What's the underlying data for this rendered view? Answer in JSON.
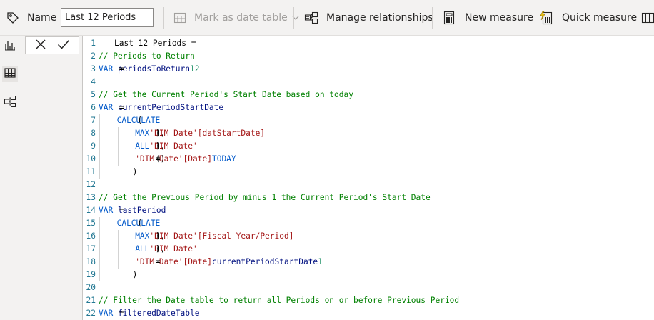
{
  "toolbar": {
    "name_label": "Name",
    "name_value": "Last 12 Periods",
    "mark_date_table_label": "Mark as date table",
    "manage_relationships_label": "Manage relationships",
    "new_measure_label": "New measure",
    "quick_measure_label": "Quick measure"
  },
  "editor": {
    "lines": [
      {
        "n": "1",
        "tokens": [
          {
            "t": "Last 12 Periods =",
            "c": "txt"
          }
        ]
      },
      {
        "n": "2",
        "tokens": [
          {
            "t": "// Periods to Return",
            "c": "cm"
          }
        ]
      },
      {
        "n": "3",
        "tokens": [
          {
            "t": "VAR ",
            "c": "kw"
          },
          {
            "t": "periodsToReturn",
            "c": "var"
          },
          {
            "t": " = ",
            "c": "txt"
          },
          {
            "t": "12",
            "c": "num"
          }
        ]
      },
      {
        "n": "4",
        "tokens": []
      },
      {
        "n": "5",
        "tokens": [
          {
            "t": "// Get the Current Period's Start Date based on today",
            "c": "cm"
          }
        ]
      },
      {
        "n": "6",
        "tokens": [
          {
            "t": "VAR ",
            "c": "kw"
          },
          {
            "t": "currentPeriodStartDate",
            "c": "var"
          },
          {
            "t": " =",
            "c": "txt"
          }
        ]
      },
      {
        "n": "7",
        "indent": 4,
        "tokens": [
          {
            "t": "CALCULATE",
            "c": "fn"
          },
          {
            "t": " (",
            "c": "txt"
          }
        ]
      },
      {
        "n": "8",
        "indent": 8,
        "tokens": [
          {
            "t": "MAX",
            "c": "fn"
          },
          {
            "t": " ( ",
            "c": "txt"
          },
          {
            "t": "'DIM Date'",
            "c": "str"
          },
          {
            "t": "[datStartDate]",
            "c": "str"
          },
          {
            "t": " ),",
            "c": "txt"
          }
        ]
      },
      {
        "n": "9",
        "indent": 8,
        "tokens": [
          {
            "t": "ALL",
            "c": "fn"
          },
          {
            "t": " ( ",
            "c": "txt"
          },
          {
            "t": "'DIM Date'",
            "c": "str"
          },
          {
            "t": " ),",
            "c": "txt"
          }
        ]
      },
      {
        "n": "10",
        "indent": 8,
        "tokens": [
          {
            "t": "'DIM Date'",
            "c": "str"
          },
          {
            "t": "[Date]",
            "c": "str"
          },
          {
            "t": " = ",
            "c": "txt"
          },
          {
            "t": "TODAY",
            "c": "fn"
          },
          {
            "t": " ()",
            "c": "txt"
          }
        ]
      },
      {
        "n": "11",
        "indent": 4,
        "tokens": [
          {
            "t": ")",
            "c": "txt"
          }
        ]
      },
      {
        "n": "12",
        "tokens": []
      },
      {
        "n": "13",
        "tokens": [
          {
            "t": "// Get the Previous Period by minus 1 the Current Period's Start Date",
            "c": "cm"
          }
        ]
      },
      {
        "n": "14",
        "tokens": [
          {
            "t": "VAR ",
            "c": "kw"
          },
          {
            "t": "lastPeriod",
            "c": "var"
          },
          {
            "t": " =",
            "c": "txt"
          }
        ]
      },
      {
        "n": "15",
        "indent": 4,
        "tokens": [
          {
            "t": "CALCULATE",
            "c": "fn"
          },
          {
            "t": " (",
            "c": "txt"
          }
        ]
      },
      {
        "n": "16",
        "indent": 8,
        "tokens": [
          {
            "t": "MAX",
            "c": "fn"
          },
          {
            "t": " ( ",
            "c": "txt"
          },
          {
            "t": "'DIM Date'",
            "c": "str"
          },
          {
            "t": "[Fiscal Year/Period]",
            "c": "str"
          },
          {
            "t": " ),",
            "c": "txt"
          }
        ]
      },
      {
        "n": "17",
        "indent": 8,
        "tokens": [
          {
            "t": "ALL",
            "c": "fn"
          },
          {
            "t": " ( ",
            "c": "txt"
          },
          {
            "t": "'DIM Date'",
            "c": "str"
          },
          {
            "t": " ),",
            "c": "txt"
          }
        ]
      },
      {
        "n": "18",
        "indent": 8,
        "tokens": [
          {
            "t": "'DIM Date'",
            "c": "str"
          },
          {
            "t": "[Date]",
            "c": "str"
          },
          {
            "t": " = ",
            "c": "txt"
          },
          {
            "t": "currentPeriodStartDate",
            "c": "var"
          },
          {
            "t": " - ",
            "c": "txt"
          },
          {
            "t": "1",
            "c": "num"
          }
        ]
      },
      {
        "n": "19",
        "indent": 4,
        "tokens": [
          {
            "t": ")",
            "c": "txt"
          }
        ]
      },
      {
        "n": "20",
        "tokens": []
      },
      {
        "n": "21",
        "tokens": [
          {
            "t": "// Filter the Date table to return all Periods on or before Previous Period",
            "c": "cm"
          }
        ]
      },
      {
        "n": "22",
        "tokens": [
          {
            "t": "VAR ",
            "c": "kw"
          },
          {
            "t": "filteredDateTable",
            "c": "var"
          },
          {
            "t": " =",
            "c": "txt"
          }
        ]
      }
    ]
  }
}
